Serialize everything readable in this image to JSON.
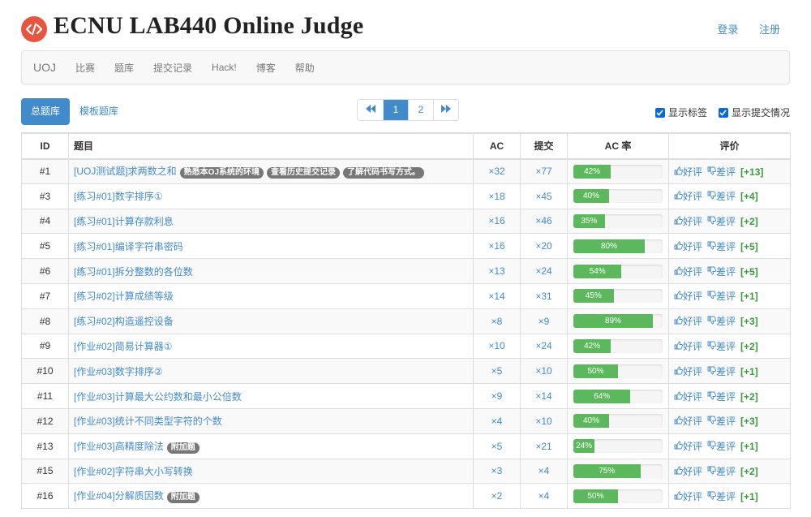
{
  "site": {
    "title": "ECNU LAB440 Online Judge",
    "login": "登录",
    "register": "注册"
  },
  "nav": {
    "brand": "UOJ",
    "items": [
      "比赛",
      "题库",
      "提交记录",
      "Hack!",
      "博客",
      "帮助"
    ]
  },
  "tabs": {
    "main": "总题库",
    "template": "模板题库"
  },
  "pagination": {
    "prev": "«",
    "pages": [
      "1",
      "2"
    ],
    "next": "»",
    "current": "1"
  },
  "options": {
    "show_tags": "显示标签",
    "show_submissions": "显示提交情况"
  },
  "table": {
    "headers": {
      "id": "ID",
      "title": "题目",
      "ac": "AC",
      "submit": "提交",
      "rate": "AC 率",
      "review": "评价"
    },
    "like_label": "好评",
    "dislike_label": "差评",
    "rows": [
      {
        "id": "#1",
        "title": "[UOJ测试题]求两数之和",
        "tags": [
          "熟悉本OJ系统的环境",
          "查看历史提交记录",
          "了解代码书写方式。"
        ],
        "ac": "×32",
        "submit": "×77",
        "rate": 42,
        "rate_label": "42%",
        "score": "[+13]"
      },
      {
        "id": "#3",
        "title": "[练习#01]数字排序①",
        "tags": [],
        "ac": "×18",
        "submit": "×45",
        "rate": 40,
        "rate_label": "40%",
        "score": "[+4]"
      },
      {
        "id": "#4",
        "title": "[练习#01]计算存款利息",
        "tags": [],
        "ac": "×16",
        "submit": "×46",
        "rate": 35,
        "rate_label": "35%",
        "score": "[+2]"
      },
      {
        "id": "#5",
        "title": "[练习#01]编译字符串密码",
        "tags": [],
        "ac": "×16",
        "submit": "×20",
        "rate": 80,
        "rate_label": "80%",
        "score": "[+5]"
      },
      {
        "id": "#6",
        "title": "[练习#01]拆分整数的各位数",
        "tags": [],
        "ac": "×13",
        "submit": "×24",
        "rate": 54,
        "rate_label": "54%",
        "score": "[+5]"
      },
      {
        "id": "#7",
        "title": "[练习#02]计算成绩等级",
        "tags": [],
        "ac": "×14",
        "submit": "×31",
        "rate": 45,
        "rate_label": "45%",
        "score": "[+1]"
      },
      {
        "id": "#8",
        "title": "[练习#02]构造遥控设备",
        "tags": [],
        "ac": "×8",
        "submit": "×9",
        "rate": 89,
        "rate_label": "89%",
        "score": "[+3]"
      },
      {
        "id": "#9",
        "title": "[作业#02]简易计算器①",
        "tags": [],
        "ac": "×10",
        "submit": "×24",
        "rate": 42,
        "rate_label": "42%",
        "score": "[+2]"
      },
      {
        "id": "#10",
        "title": "[作业#03]数字排序②",
        "tags": [],
        "ac": "×5",
        "submit": "×10",
        "rate": 50,
        "rate_label": "50%",
        "score": "[+1]"
      },
      {
        "id": "#11",
        "title": "[作业#03]计算最大公约数和最小公倍数",
        "tags": [],
        "ac": "×9",
        "submit": "×14",
        "rate": 64,
        "rate_label": "64%",
        "score": "[+2]"
      },
      {
        "id": "#12",
        "title": "[作业#03]统计不同类型字符的个数",
        "tags": [],
        "ac": "×4",
        "submit": "×10",
        "rate": 40,
        "rate_label": "40%",
        "score": "[+3]"
      },
      {
        "id": "#13",
        "title": "[作业#03]高精度除法",
        "tags": [
          "附加题"
        ],
        "ac": "×5",
        "submit": "×21",
        "rate": 24,
        "rate_label": "24%",
        "score": "[+1]"
      },
      {
        "id": "#15",
        "title": "[作业#02]字符串大小写转换",
        "tags": [],
        "ac": "×3",
        "submit": "×4",
        "rate": 75,
        "rate_label": "75%",
        "score": "[+2]"
      },
      {
        "id": "#16",
        "title": "[作业#04]分解质因数",
        "tags": [
          "附加题"
        ],
        "ac": "×2",
        "submit": "×4",
        "rate": 50,
        "rate_label": "50%",
        "score": "[+1]"
      }
    ]
  }
}
